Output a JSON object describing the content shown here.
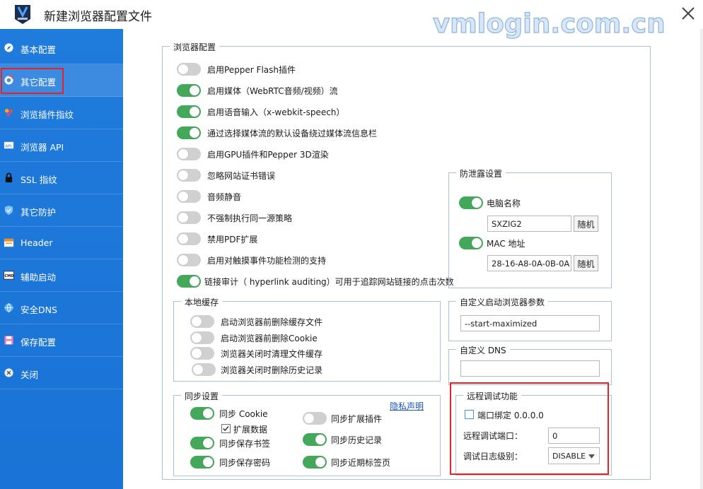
{
  "window": {
    "title": "新建浏览器配置文件",
    "watermark": "vmlogin.com.cn"
  },
  "sidebar": {
    "items": [
      {
        "label": "基本配置",
        "icon": "compass-icon"
      },
      {
        "label": "其它配置",
        "icon": "chrome-icon"
      },
      {
        "label": "浏览插件指纹",
        "icon": "plugin-icon"
      },
      {
        "label": "浏览器 API",
        "icon": "api-icon"
      },
      {
        "label": "SSL 指纹",
        "icon": "lock-icon"
      },
      {
        "label": "其它防护",
        "icon": "shield-icon"
      },
      {
        "label": "Header",
        "icon": "header-icon"
      },
      {
        "label": "辅助启动",
        "icon": "cmd-icon"
      },
      {
        "label": "安全DNS",
        "icon": "dns-icon"
      },
      {
        "label": "保存配置",
        "icon": "save-icon"
      },
      {
        "label": "关闭",
        "icon": "close-circle-icon"
      }
    ],
    "active_index": 1
  },
  "browser_config": {
    "legend": "浏览器配置",
    "options": [
      {
        "label": "启用Pepper Flash插件",
        "on": false
      },
      {
        "label": "启用媒体（WebRTC音频/视频）流",
        "on": true
      },
      {
        "label": "启用语音输入（x-webkit-speech）",
        "on": true
      },
      {
        "label": "通过选择媒体流的默认设备绕过媒体流信息栏",
        "on": true
      },
      {
        "label": "启用GPU插件和Pepper 3D渲染",
        "on": false
      },
      {
        "label": "忽略网站证书错误",
        "on": false
      },
      {
        "label": "音频静音",
        "on": false
      },
      {
        "label": "不强制执行同一源策略",
        "on": false
      },
      {
        "label": "禁用PDF扩展",
        "on": false
      },
      {
        "label": "启用对触摸事件功能检测的支持",
        "on": false
      },
      {
        "label": "链接审计（ hyperlink auditing）可用于追踪网站链接的点击次数",
        "on": true
      }
    ]
  },
  "anti_leak": {
    "legend": "防泄露设置",
    "computer_name_label": "电脑名称",
    "computer_name_on": true,
    "computer_name_value": "SXZIG2",
    "random_label": "随机",
    "mac_label": "MAC 地址",
    "mac_on": true,
    "mac_value": "28-16-A8-0A-0B-0A",
    "random_label2": "随机"
  },
  "local_cache": {
    "legend": "本地缓存",
    "options": [
      {
        "label": "启动浏览器前删除缓存文件",
        "on": false
      },
      {
        "label": "启动浏览器前删除Cookie",
        "on": false
      },
      {
        "label": "浏览器关闭时清理文件缓存",
        "on": false
      },
      {
        "label": "浏览器关闭时删除历史记录",
        "on": false
      }
    ]
  },
  "launch_params": {
    "legend": "自定义启动浏览器参数",
    "value": "--start-maximized"
  },
  "custom_dns": {
    "legend": "自定义 DNS",
    "value": ""
  },
  "sync": {
    "legend": "同步设置",
    "privacy_link": "隐私声明",
    "cookie_label": "同步 Cookie",
    "cookie_on": true,
    "ext_data_label": "扩展数据",
    "ext_data_checked": true,
    "ext_label": "同步扩展插件",
    "ext_on": false,
    "bookmarks_label": "同步保存书签",
    "bookmarks_on": true,
    "history_label": "同步历史记录",
    "history_on": true,
    "passwords_label": "同步保存密码",
    "passwords_on": true,
    "tabs_label": "同步近期标签页",
    "tabs_on": true
  },
  "remote_debug": {
    "legend": "远程调试功能",
    "bind_label": "端口绑定 0.0.0.0",
    "bind_checked": false,
    "port_label": "远程调试端口：",
    "port_value": "0",
    "log_label": "调试日志级别：",
    "log_value": "DISABLE"
  },
  "colors": {
    "sidebar": "#1e78da",
    "toggle_on": "#43a85a",
    "toggle_off": "#d0d0d0",
    "highlight": "#e0242a",
    "link": "#1a55b5"
  }
}
